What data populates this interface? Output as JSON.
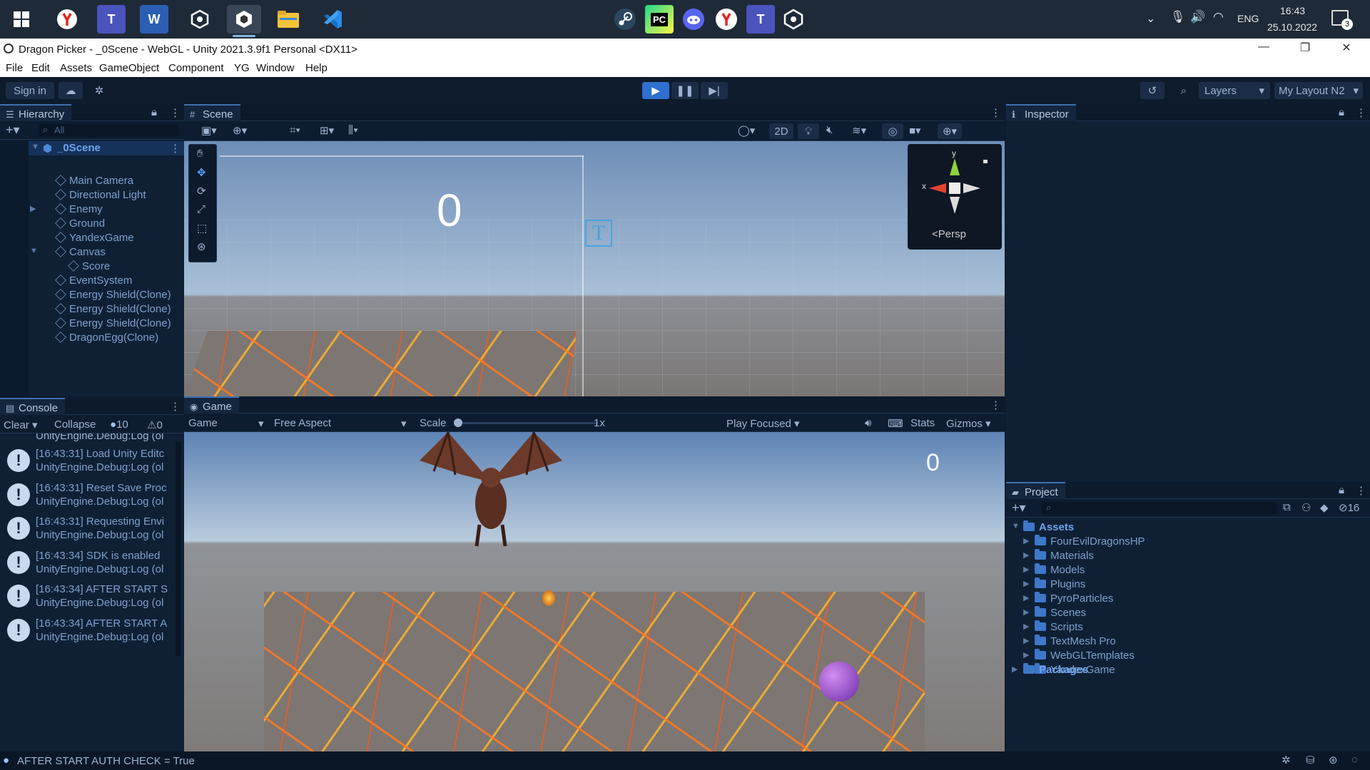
{
  "taskbar": {
    "clock_time": "16:43",
    "clock_date": "25.10.2022",
    "language": "ENG",
    "notification_count": "3",
    "app_letters": {
      "teams": "T",
      "word": "W",
      "pycharm": "PC",
      "teams2": "T"
    }
  },
  "window": {
    "title": "Dragon Picker - _0Scene - WebGL - Unity 2021.3.9f1 Personal <DX11>",
    "minimize": "—",
    "maximize": "❐",
    "close": "✕"
  },
  "menu": [
    "File",
    "Edit",
    "Assets",
    "GameObject",
    "Component",
    "YG",
    "Window",
    "Help"
  ],
  "toolbar": {
    "sign_in": "Sign in",
    "layers": "Layers",
    "layout": "My Layout N2"
  },
  "hierarchy": {
    "tab": "Hierarchy",
    "search_placeholder": "All",
    "scene": "_0Scene",
    "items": [
      {
        "label": "Main Camera",
        "indent": 1,
        "expand": ""
      },
      {
        "label": "Directional Light",
        "indent": 1,
        "expand": ""
      },
      {
        "label": "Enemy",
        "indent": 1,
        "expand": "▶"
      },
      {
        "label": "Ground",
        "indent": 1,
        "expand": ""
      },
      {
        "label": "YandexGame",
        "indent": 1,
        "expand": ""
      },
      {
        "label": "Canvas",
        "indent": 1,
        "expand": "▼"
      },
      {
        "label": "Score",
        "indent": 2,
        "expand": ""
      },
      {
        "label": "EventSystem",
        "indent": 1,
        "expand": ""
      },
      {
        "label": "Energy Shield(Clone)",
        "indent": 1,
        "expand": ""
      },
      {
        "label": "Energy Shield(Clone)",
        "indent": 1,
        "expand": ""
      },
      {
        "label": "Energy Shield(Clone)",
        "indent": 1,
        "expand": ""
      },
      {
        "label": "DragonEgg(Clone)",
        "indent": 1,
        "expand": ""
      }
    ]
  },
  "scene": {
    "tab": "Scene",
    "mode_2d": "2D",
    "persp": "Persp",
    "score_text": "0",
    "gizmo_y": "y",
    "gizmo_x": "x"
  },
  "console": {
    "tab": "Console",
    "clear": "Clear",
    "collapse": "Collapse",
    "info_count": "10",
    "warn_count": "0",
    "top_partial": "UnityEngine.Debug:Log (ol",
    "entries": [
      {
        "line1": "[16:43:31] Load Unity Editc",
        "line2": "UnityEngine.Debug:Log (ol"
      },
      {
        "line1": "[16:43:31] Reset Save Proc",
        "line2": "UnityEngine.Debug:Log (ol"
      },
      {
        "line1": "[16:43:31] Requesting Envi",
        "line2": "UnityEngine.Debug:Log (ol"
      },
      {
        "line1": "[16:43:34] SDK is enabled",
        "line2": "UnityEngine.Debug:Log (ol"
      },
      {
        "line1": "[16:43:34] AFTER START S",
        "line2": "UnityEngine.Debug:Log (ol"
      },
      {
        "line1": "[16:43:34] AFTER START A",
        "line2": "UnityEngine.Debug:Log (ol"
      }
    ]
  },
  "game": {
    "tab": "Game",
    "display": "Game",
    "aspect": "Free Aspect",
    "scale_label": "Scale",
    "scale_value": "1x",
    "play_focused": "Play Focused",
    "stats": "Stats",
    "gizmos": "Gizmos",
    "score": "0"
  },
  "inspector": {
    "tab": "Inspector"
  },
  "project": {
    "tab": "Project",
    "hidden_count": "16",
    "root": "Assets",
    "folders": [
      "FourEvilDragonsHP",
      "Materials",
      "Models",
      "Plugins",
      "PyroParticles",
      "Scenes",
      "Scripts",
      "TextMesh Pro",
      "WebGLTemplates",
      "YandexGame"
    ],
    "packages": "Packages"
  },
  "status": {
    "message": "AFTER START AUTH CHECK = True"
  }
}
